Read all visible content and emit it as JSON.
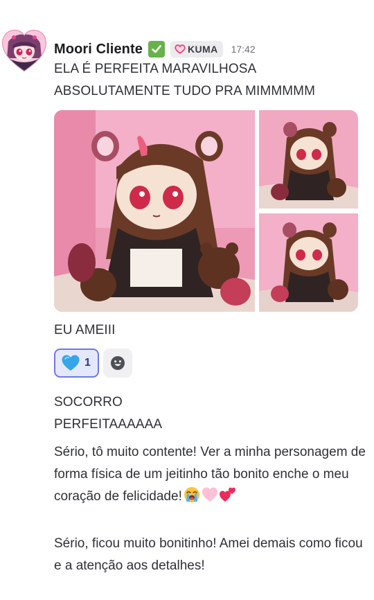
{
  "author": {
    "name": "Moori Cliente",
    "tag": "KUMA",
    "time": "17:42"
  },
  "messages": {
    "line1": "ELA É PERFEITA MARAVILHOSA",
    "line2": "ABSOLUTAMENTE TUDO PRA MIMMMMM",
    "line3": "EU AMEIII",
    "line4": "SOCORRO",
    "line5": "PERFEITAAAAAA",
    "para1": "Sério, tô muito contente! Ver a minha personagem de forma física de um jeitinho tão bonito enche o meu coração de felicidade!",
    "para2": "Sério, ficou muito bonitinho! Amei demais como ficou e a atenção aos detalhes!"
  },
  "reactions": [
    {
      "emoji": "blue-heart-icon",
      "count": "1"
    }
  ],
  "icons": {
    "verified": "check-mark-icon",
    "tag": "heart-outline-icon",
    "add_reaction": "smiley-add-icon",
    "para1_emojis": [
      "loudly-crying-face-icon",
      "pink-heart-icon",
      "two-hearts-icon"
    ]
  },
  "colors": {
    "verified_bg": "#67b349",
    "reaction_border": "#6e79e4",
    "reaction_bg": "#e5e8fc",
    "tag_heart": "#e6467a",
    "text": "#2e3035"
  }
}
